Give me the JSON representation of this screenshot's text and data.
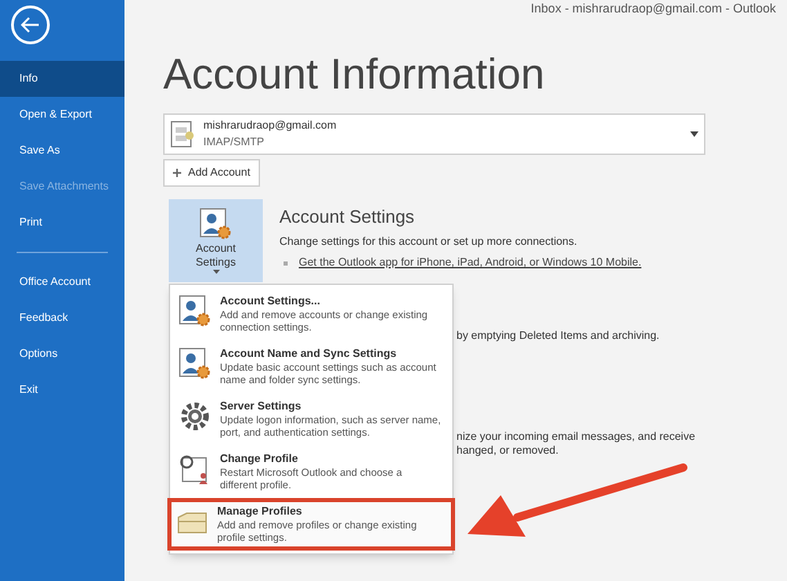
{
  "window": {
    "title": "Inbox - mishrarudraop@gmail.com - Outlook"
  },
  "sidebar": {
    "groups": [
      [
        {
          "label": "Info",
          "selected": true,
          "disabled": false
        },
        {
          "label": "Open & Export",
          "selected": false,
          "disabled": false
        },
        {
          "label": "Save As",
          "selected": false,
          "disabled": false
        },
        {
          "label": "Save Attachments",
          "selected": false,
          "disabled": true
        },
        {
          "label": "Print",
          "selected": false,
          "disabled": false
        }
      ],
      [
        {
          "label": "Office Account",
          "selected": false,
          "disabled": false
        },
        {
          "label": "Feedback",
          "selected": false,
          "disabled": false
        },
        {
          "label": "Options",
          "selected": false,
          "disabled": false
        },
        {
          "label": "Exit",
          "selected": false,
          "disabled": false
        }
      ]
    ]
  },
  "page_title": "Account Information",
  "account": {
    "email": "mishrarudraop@gmail.com",
    "type": "IMAP/SMTP"
  },
  "add_account": "Add Account",
  "account_settings": {
    "button": "Account Settings",
    "heading": "Account Settings",
    "description": "Change settings for this account or set up more connections.",
    "link": "Get the Outlook app for iPhone, iPad, Android, or Windows 10 Mobile."
  },
  "background_text": [
    "by emptying Deleted Items and archiving.",
    "nize your incoming email messages, and receive",
    "hanged, or removed."
  ],
  "menu": [
    {
      "kind": "account",
      "title": "Account Settings...",
      "description": "Add and remove accounts or change existing connection settings.",
      "highlighted": false
    },
    {
      "kind": "account",
      "title": "Account Name and Sync Settings",
      "description": "Update basic account settings such as account name and folder sync settings.",
      "highlighted": false
    },
    {
      "kind": "gear",
      "title": "Server Settings",
      "description": "Update logon information, such as server name, port, and authentication settings.",
      "highlighted": false
    },
    {
      "kind": "profile",
      "title": "Change Profile",
      "description": "Restart Microsoft Outlook and choose a different profile.",
      "highlighted": false
    },
    {
      "kind": "folder",
      "title": "Manage Profiles",
      "description": "Add and remove profiles or change existing profile settings.",
      "highlighted": true
    }
  ]
}
